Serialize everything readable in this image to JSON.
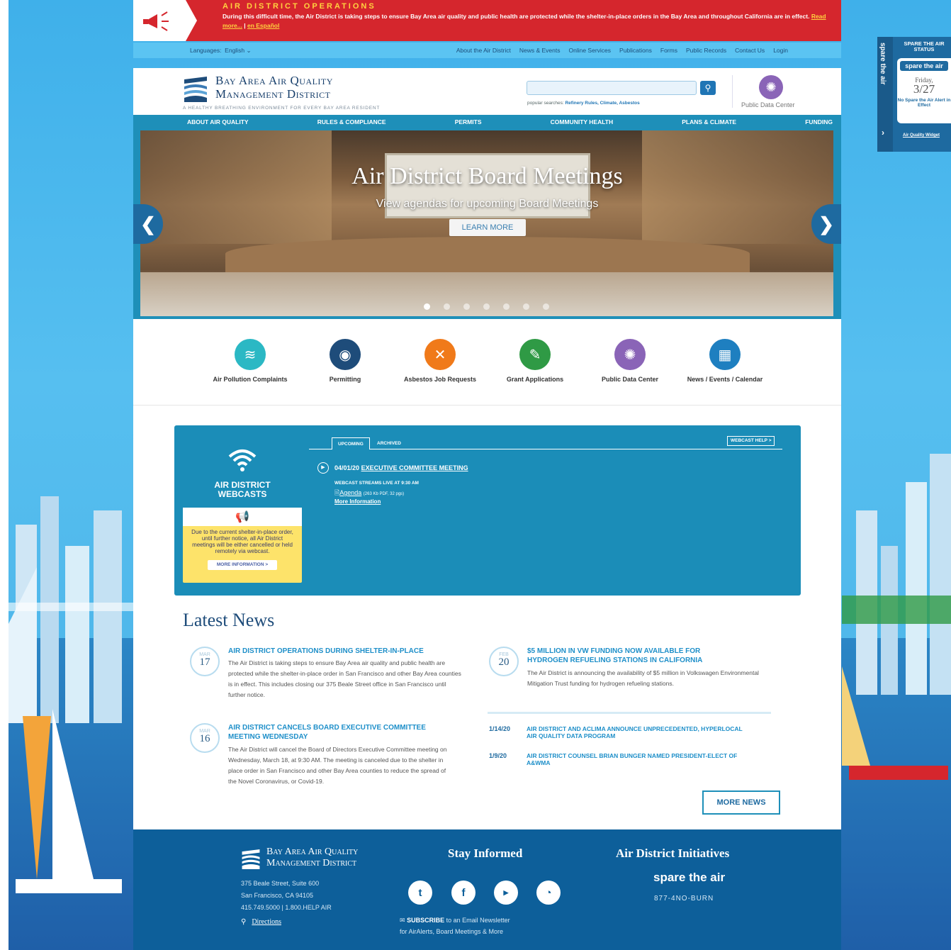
{
  "alert": {
    "title": "AIR DISTRICT OPERATIONS",
    "text": "During this difficult time, the Air District is taking steps to ensure Bay Area air quality and public health are protected while the shelter-in-place orders in the Bay Area and throughout California are in effect.",
    "read_more": "Read more...",
    "separator": " | ",
    "espanol": "en Español"
  },
  "utility": {
    "languages_label": "Languages:",
    "language_value": "English",
    "links": [
      "About the Air District",
      "News & Events",
      "Online Services",
      "Publications",
      "Forms",
      "Public Records",
      "Contact Us",
      "Login"
    ]
  },
  "header": {
    "logo_line1": "Bay Area Air Quality",
    "logo_line2": "Management District",
    "tagline": "A HEALTHY BREATHING ENVIRONMENT FOR EVERY BAY AREA RESIDENT",
    "popular_label": "popular searches:",
    "popular_links": "Refinery Rules, Climate, Asbestos",
    "public_data_center": "Public Data Center"
  },
  "nav": [
    "ABOUT AIR QUALITY",
    "RULES & COMPLIANCE",
    "PERMITS",
    "COMMUNITY HEALTH",
    "PLANS & CLIMATE",
    "FUNDING"
  ],
  "hero": {
    "title": "Air District Board Meetings",
    "subtitle": "View agendas for upcoming Board Meetings",
    "button": "LEARN MORE",
    "prev": "❮",
    "next": "❯",
    "slide_count": 7,
    "active_slide": 1
  },
  "quick_links": [
    {
      "label": "Air Pollution Complaints",
      "color": "#2bb8c4",
      "icon": "wind-icon"
    },
    {
      "label": "Permitting",
      "color": "#1e4c7a",
      "icon": "permit-icon"
    },
    {
      "label": "Asbestos Job Requests",
      "color": "#f07a1a",
      "icon": "tools-icon"
    },
    {
      "label": "Grant Applications",
      "color": "#2f9a45",
      "icon": "grant-icon"
    },
    {
      "label": "Public Data Center",
      "color": "#8a64b7",
      "icon": "data-icon"
    },
    {
      "label": "News / Events / Calendar",
      "color": "#1e7fc0",
      "icon": "calendar-icon"
    }
  ],
  "webcast": {
    "title": "AIR DISTRICT WEBCASTS",
    "note": "Due to the current shelter-in-place order, until further notice, all Air District meetings will be either cancelled or held remotely via webcast.",
    "note_button": "MORE INFORMATION >",
    "tab_upcoming": "UPCOMING",
    "tab_archived": "ARCHIVED",
    "help": "WEBCAST HELP >",
    "event_date": "04/01/20",
    "event_title": "EXECUTIVE COMMITTEE MEETING",
    "event_stream": "WEBCAST STREAMS LIVE AT 9:30 AM",
    "event_agenda": "Agenda",
    "event_agenda_meta": "(263 Kb PDF, 32 pgs)",
    "event_more": "More Information"
  },
  "news": {
    "title": "Latest News",
    "featured": [
      {
        "month": "MAR",
        "day": "17",
        "headline": "AIR DISTRICT OPERATIONS DURING SHELTER-IN-PLACE",
        "body": "The Air District is taking steps to ensure Bay Area air quality and public health are protected while the shelter-in-place order in San Francisco and other Bay Area counties is in effect. This includes closing our 375 Beale Street office in San Francisco until further notice."
      },
      {
        "month": "MAR",
        "day": "16",
        "headline": "AIR DISTRICT CANCELS BOARD EXECUTIVE COMMITTEE MEETING WEDNESDAY",
        "body": "The Air District will cancel the Board of Directors Executive Committee meeting on Wednesday, March 18, at 9:30 AM. The meeting is canceled due to the shelter in place order in San Francisco and other Bay Area counties to reduce the spread of the Novel Coronavirus, or Covid-19."
      },
      {
        "month": "FEB",
        "day": "20",
        "headline": "$5 MILLION IN VW FUNDING NOW AVAILABLE FOR HYDROGEN REFUELING STATIONS IN CALIFORNIA",
        "body": "The Air District is announcing the availability of $5 million in Volkswagen Environmental Mitigation Trust funding for hydrogen refueling stations."
      }
    ],
    "list": [
      {
        "date": "1/14/20",
        "title": "AIR DISTRICT AND ACLIMA ANNOUNCE UNPRECEDENTED, HYPERLOCAL AIR QUALITY DATA PROGRAM"
      },
      {
        "date": "1/9/20",
        "title": "AIR DISTRICT COUNSEL BRIAN BUNGER NAMED PRESIDENT-ELECT OF A&WMA"
      }
    ],
    "more_button": "MORE NEWS"
  },
  "footer": {
    "logo_line1": "Bay Area Air Quality",
    "logo_line2": "Management District",
    "address1": "375 Beale Street, Suite 600",
    "address2": "San Francisco, CA 94105",
    "phone": "415.749.5000 | 1.800.HELP AIR",
    "directions": "Directions",
    "stay_informed": "Stay Informed",
    "subscribe_bold": "SUBSCRIBE",
    "subscribe_text": " to an Email Newsletter",
    "subscribe_line2": "for AirAlerts, Board Meetings & More",
    "initiatives": "Air District Initiatives",
    "spare_the_air": "spare the air",
    "hotline": "877-4NO-BURN"
  },
  "widget": {
    "side_label": "spare the air",
    "heading": "SPARE THE AIR STATUS",
    "brand": "spare the air",
    "day": "Friday,",
    "date": "3/27",
    "status": "No Spare the Air Alert in Effect",
    "link": "Air Quality Widget"
  }
}
